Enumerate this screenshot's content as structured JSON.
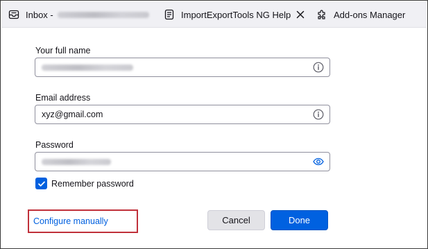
{
  "tabs": [
    {
      "label": "Inbox -",
      "icon": "inbox-tray-icon",
      "has_blurred_suffix": true
    },
    {
      "label": "ImportExportTools NG Help",
      "icon": "document-icon",
      "closable": true
    },
    {
      "label": "Add-ons Manager",
      "icon": "puzzle-piece-icon"
    }
  ],
  "form": {
    "full_name": {
      "label": "Your full name",
      "value_redacted": true,
      "icon": "info-icon"
    },
    "email": {
      "label": "Email address",
      "value": "xyz@gmail.com",
      "icon": "info-icon"
    },
    "password": {
      "label": "Password",
      "value_redacted": true,
      "icon": "eye-icon"
    },
    "remember": {
      "label": "Remember password",
      "checked": true
    }
  },
  "actions": {
    "configure_manually": "Configure manually",
    "cancel": "Cancel",
    "done": "Done"
  },
  "colors": {
    "accent": "#0060df",
    "highlight_border": "#c0303a",
    "tabbar_bg": "#f0f0f4"
  }
}
